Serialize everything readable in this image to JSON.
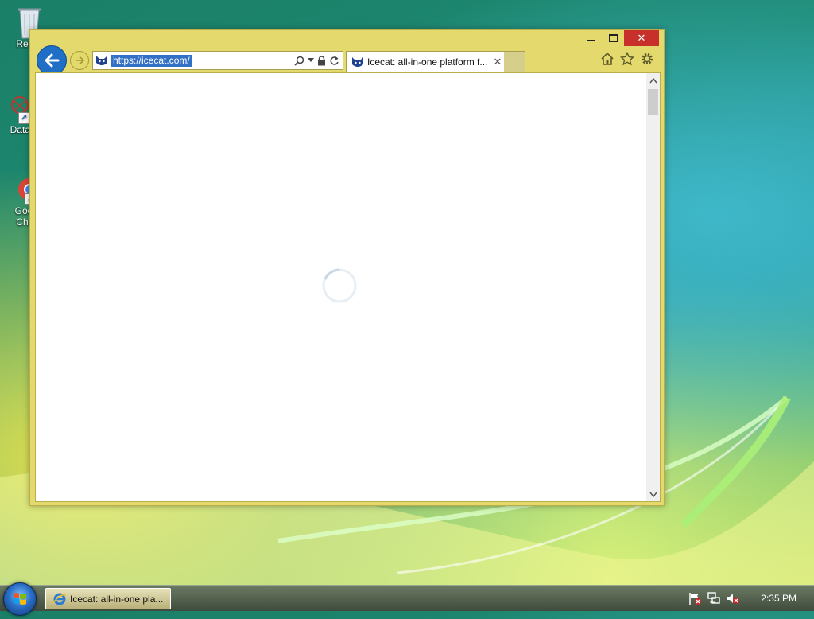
{
  "desktop": {
    "icons": [
      {
        "label": "Recyc",
        "name": "recycle-bin"
      },
      {
        "label": "DataW",
        "name": "datawrapper-shortcut"
      },
      {
        "label": "Goo Chr",
        "name": "google-chrome-shortcut"
      }
    ]
  },
  "browser": {
    "address": {
      "url": "https://icecat.com/"
    },
    "tab": {
      "title": "Icecat: all-in-one platform f..."
    },
    "window_buttons": {
      "minimize": "minimize",
      "maximize": "maximize",
      "close": "✕"
    }
  },
  "taskbar": {
    "active_item_label": "Icecat: all-in-one pla...",
    "clock": "2:35 PM"
  },
  "colors": {
    "accent": "#1e6fc5",
    "window_frame": "#e4d96c",
    "close_red": "#c7302b"
  },
  "icons": [
    "back-arrow-icon",
    "forward-arrow-icon",
    "search-icon",
    "lock-icon",
    "refresh-icon",
    "home-icon",
    "star-icon",
    "gear-icon",
    "loading-spinner-icon",
    "ie-icon",
    "flag-icon",
    "network-icon",
    "volume-muted-icon"
  ]
}
